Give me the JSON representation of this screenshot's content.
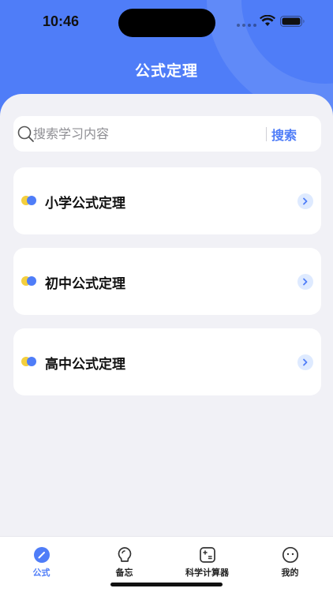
{
  "status_bar": {
    "time": "10:46"
  },
  "header": {
    "title": "公式定理"
  },
  "search": {
    "placeholder": "搜索学习内容",
    "value": "",
    "button_label": "搜索"
  },
  "categories": [
    {
      "label": "小学公式定理"
    },
    {
      "label": "初中公式定理"
    },
    {
      "label": "高中公式定理"
    }
  ],
  "tabbar": {
    "items": [
      {
        "label": "公式",
        "icon": "pencil-icon",
        "active": true
      },
      {
        "label": "备忘",
        "icon": "lightbulb-icon",
        "active": false
      },
      {
        "label": "科学计算器",
        "icon": "calculator-icon",
        "active": false
      },
      {
        "label": "我的",
        "icon": "face-icon",
        "active": false
      }
    ]
  },
  "colors": {
    "accent": "#4f7df8",
    "background": "#f1f1f6",
    "bullet_yellow": "#f4cf3d"
  }
}
